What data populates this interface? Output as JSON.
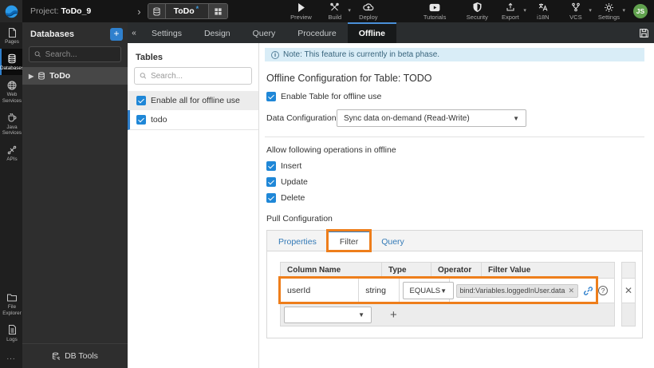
{
  "topbar": {
    "project_label": "Project:",
    "project_name": "ToDo_9",
    "app_selector": {
      "name": "ToDo",
      "modified_marker": "*"
    },
    "actions": {
      "preview": "Preview",
      "build": "Build",
      "deploy": "Deploy",
      "tutorials": "Tutorials"
    },
    "right_actions": {
      "security": "Security",
      "export": "Export",
      "i18n": "i18N",
      "vcs": "VCS",
      "settings": "Settings"
    },
    "avatar_initials": "JS"
  },
  "rail": {
    "items": [
      {
        "label": "Pages"
      },
      {
        "label": "Databases"
      },
      {
        "label": "Web Services"
      },
      {
        "label": "Java Services"
      },
      {
        "label": "APIs"
      },
      {
        "label": "File Explorer"
      },
      {
        "label": "Logs"
      }
    ],
    "more": "..."
  },
  "db_panel": {
    "title": "Databases",
    "add_label": "+",
    "search_placeholder": "Search...",
    "tree_item": "ToDo",
    "db_tools": "DB Tools"
  },
  "tabbar": {
    "tabs": [
      "Settings",
      "Design",
      "Query",
      "Procedure",
      "Offline"
    ],
    "active": "Offline",
    "collapse": "«"
  },
  "tables_panel": {
    "title": "Tables",
    "search_placeholder": "Search...",
    "enable_all": "Enable all for offline use",
    "tables": [
      {
        "name": "todo",
        "checked": true
      }
    ]
  },
  "main": {
    "note": "Note: This feature is currently in beta phase.",
    "heading": "Offline Configuration for Table: TODO",
    "enable_table": "Enable Table for offline use",
    "data_config_label": "Data Configuration",
    "data_config_value": "Sync data on-demand (Read-Write)",
    "operations_label": "Allow following operations in offline",
    "operations": [
      "Insert",
      "Update",
      "Delete"
    ],
    "pull_config_label": "Pull Configuration",
    "pull_tabs": [
      "Properties",
      "Filter",
      "Query"
    ],
    "pull_active_tab": "Filter",
    "filter_table": {
      "headers": [
        "Column Name",
        "Type",
        "Operator",
        "Filter Value"
      ],
      "row": {
        "column_name": "userId",
        "type": "string",
        "operator": "EQUALS",
        "filter_value": "bind:Variables.loggedInUser.data"
      },
      "add_label": "+"
    }
  },
  "colors": {
    "accent_blue": "#2f80cd",
    "annotation_orange": "#ee7e1b",
    "note_bg": "#d9edf7",
    "checkbox_blue": "#1f87d7",
    "avatar_green": "#61a14e",
    "tab_link_blue": "#337ab7"
  }
}
